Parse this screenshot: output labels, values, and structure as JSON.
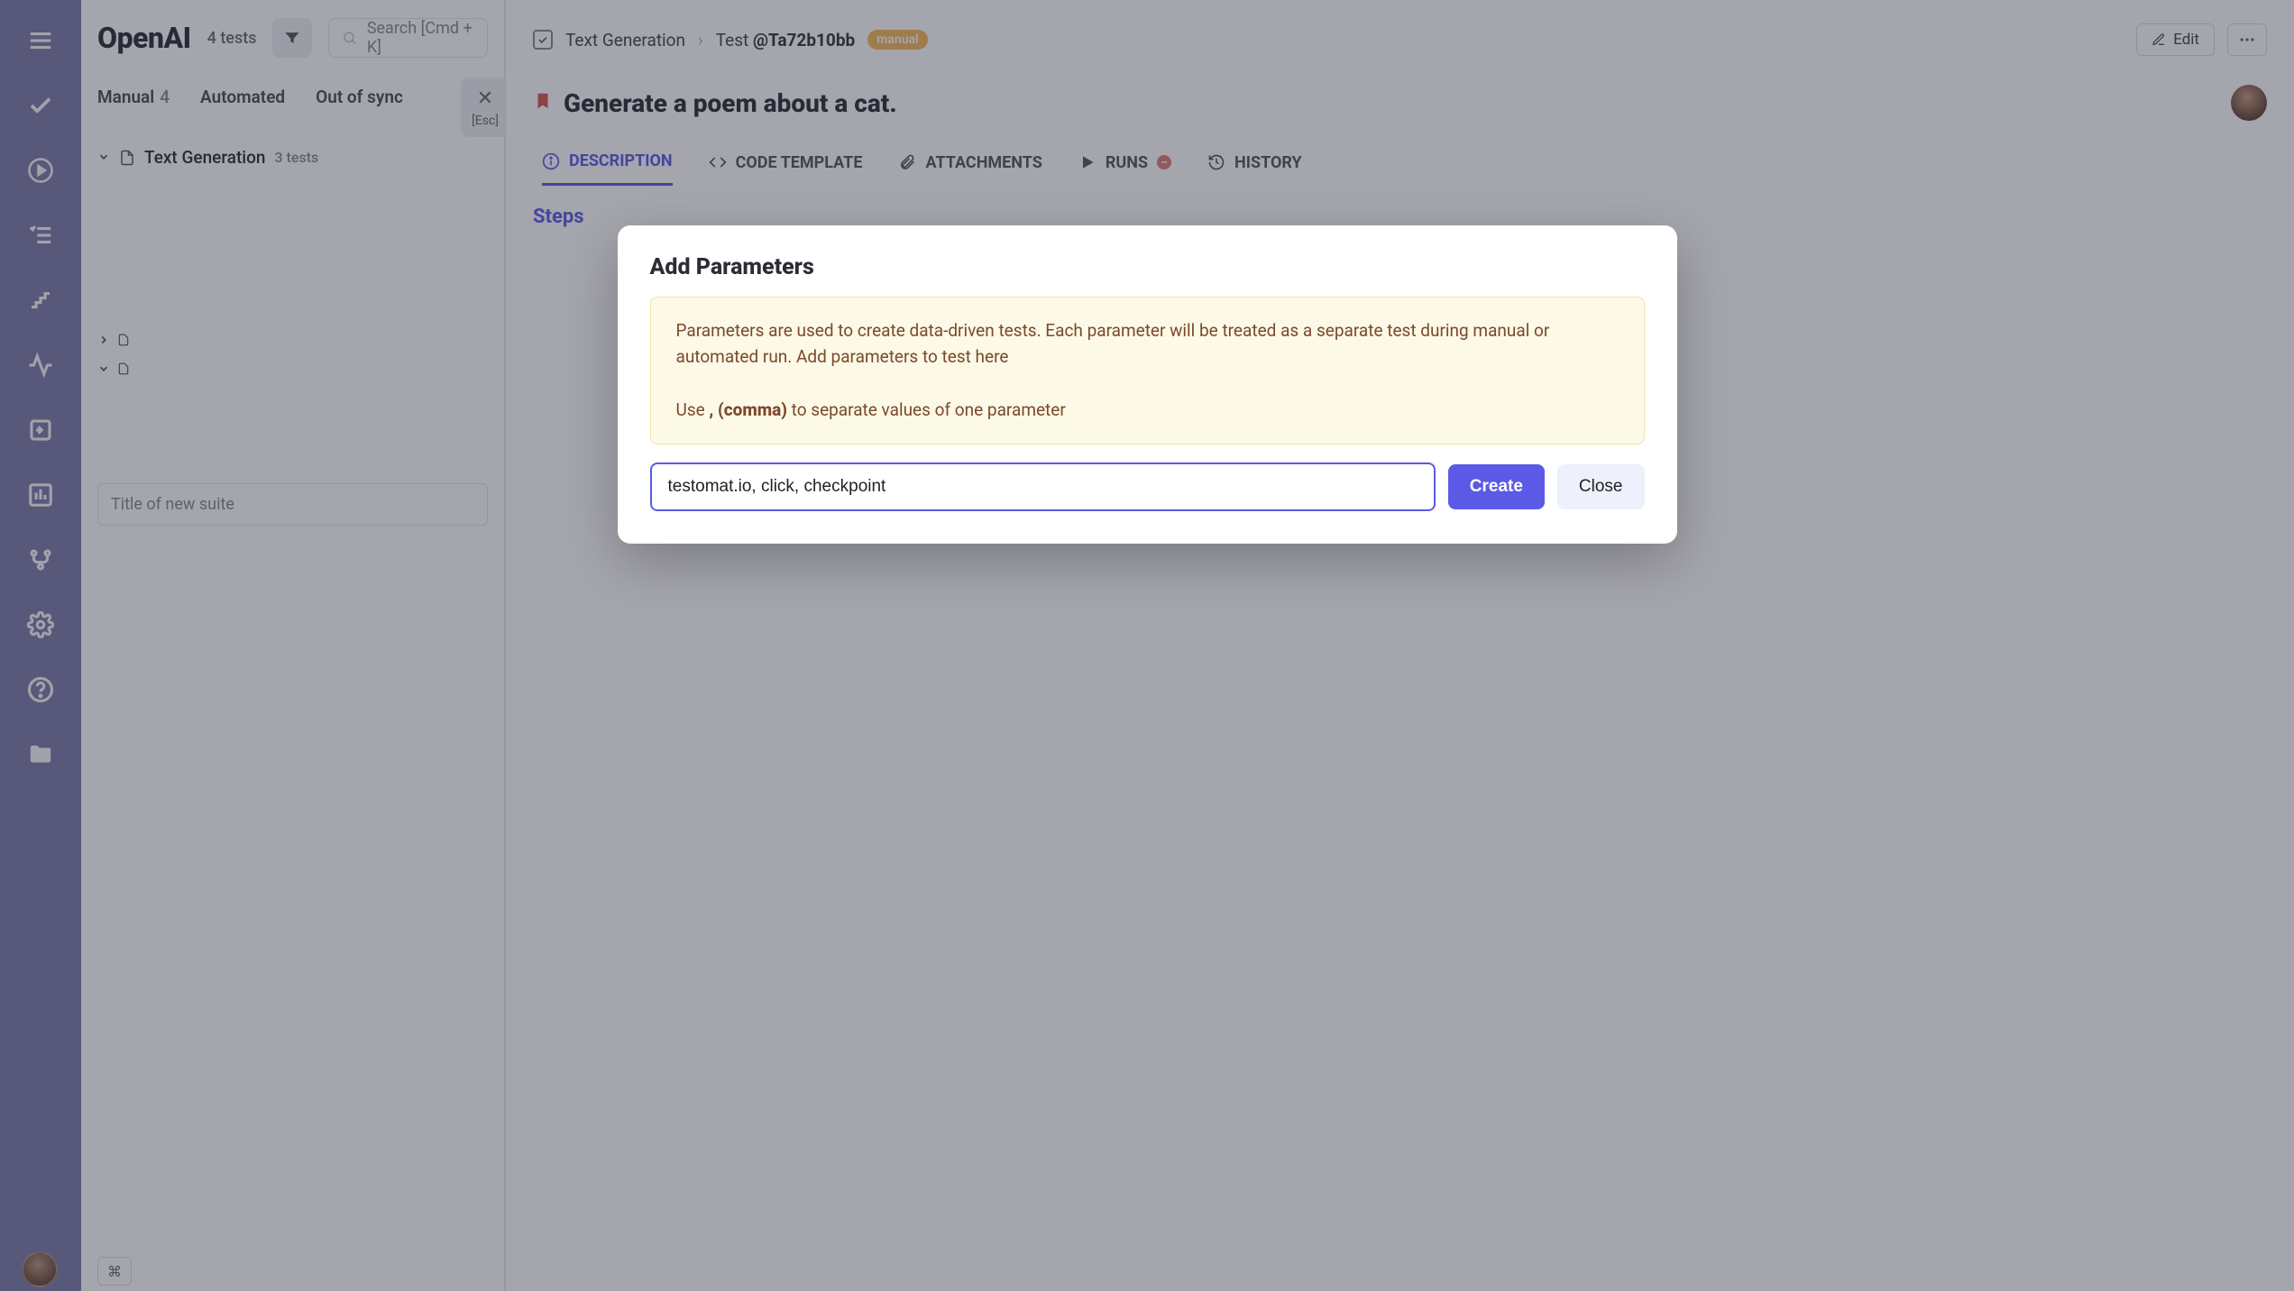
{
  "sidebar": {
    "items": [
      "menu",
      "check",
      "play",
      "checklist",
      "steps",
      "pulse",
      "import",
      "analytics",
      "branch",
      "settings",
      "help",
      "folder"
    ]
  },
  "project": {
    "title": "OpenAI",
    "tests_count": "4 tests",
    "search_placeholder": "Search [Cmd + K]"
  },
  "left_tabs": {
    "manual_label": "Manual",
    "manual_count": "4",
    "automated_label": "Automated",
    "out_of_sync_label": "Out of sync"
  },
  "suite": {
    "name": "Text Generation",
    "count": "3 tests"
  },
  "new_suite_placeholder": "Title of new suite",
  "esc_label": "[Esc]",
  "breadcrumb": {
    "suite": "Text Generation",
    "test_prefix": "Test ",
    "test_id": "@Ta72b10bb",
    "badge": "manual",
    "edit_label": "Edit"
  },
  "test": {
    "title": "Generate a poem about a cat."
  },
  "detail_tabs": {
    "description": "DESCRIPTION",
    "code_template": "CODE TEMPLATE",
    "attachments": "ATTACHMENTS",
    "runs": "RUNS",
    "history": "HISTORY"
  },
  "steps_heading": "Steps",
  "modal": {
    "title": "Add Parameters",
    "info_line1": "Parameters are used to create data-driven tests. Each parameter will be treated as a separate test during manual or automated run. Add parameters to test here",
    "info_use": "Use ",
    "info_comma": ", (comma)",
    "info_rest": " to separate values of one parameter",
    "input_value": "testomat.io, click, checkpoint",
    "create_label": "Create",
    "close_label": "Close"
  }
}
